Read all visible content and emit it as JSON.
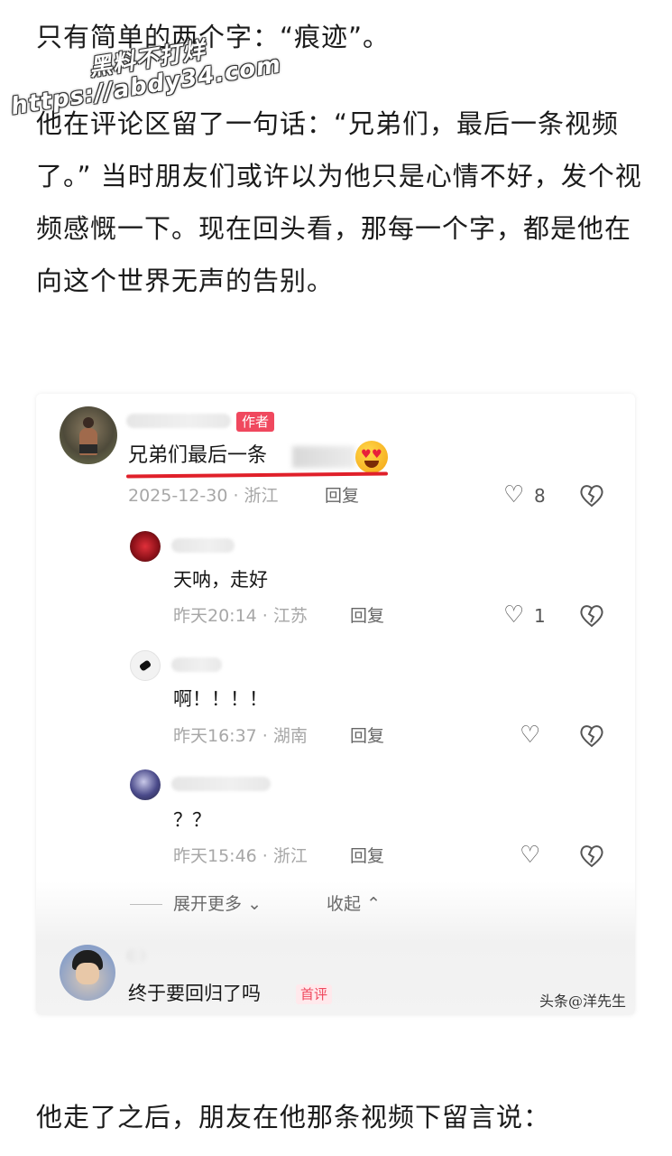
{
  "article": {
    "p1": "只有简单的两个字：“痕迹”。",
    "p2": "他在评论区留了一句话：“兄弟们，最后一条视频了。” 当时朋友们或许以为他只是心情不好，发个视频感慨一下。现在回头看，那每一个字，都是他在向这个世界无声的告别。",
    "p3": "他走了之后，朋友在他那条视频下留言说："
  },
  "watermark": {
    "line1": "黑料不打烊",
    "line2": "https://abdy34.com"
  },
  "comment_card": {
    "main": {
      "badge": "作者",
      "text": "兄弟们最后一条",
      "date": "2025-12-30 · 浙江",
      "reply_label": "回复",
      "likes": "8"
    },
    "replies": [
      {
        "text": "天呐，走好",
        "meta": "昨天20:14 · 江苏",
        "reply_label": "回复",
        "likes": "1"
      },
      {
        "text": "啊！！！！",
        "meta": "昨天16:37 · 湖南",
        "reply_label": "回复",
        "likes": ""
      },
      {
        "text": "？？",
        "meta": "昨天15:46 · 浙江",
        "reply_label": "回复",
        "likes": ""
      }
    ],
    "expand_label": "展开更多",
    "collapse_label": "收起",
    "last_comment": {
      "text": "终于要回归了吗",
      "badge": "首评"
    },
    "source": "头条@洋先生"
  },
  "icons": {
    "like": "heart-outline-icon",
    "dislike": "broken-heart-icon",
    "expand": "chevron-down-icon",
    "collapse": "chevron-up-icon"
  },
  "colors": {
    "author_badge": "#f0485e",
    "underline": "#e0202a",
    "meta_text": "#a7a7a7"
  }
}
